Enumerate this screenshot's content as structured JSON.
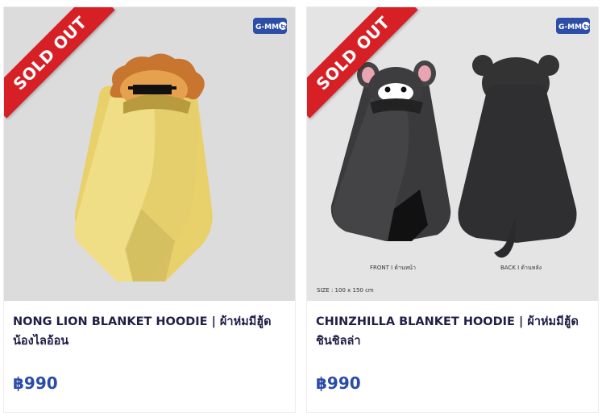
{
  "products": [
    {
      "badge": "SOLD OUT",
      "logo_text": "GMMTV",
      "title_line1": "NONG LION BLANKET HOODIE | ผ้าห่มมีฮู้ด",
      "title_line2": "น้องไลอ้อน",
      "price": "฿990"
    },
    {
      "badge": "SOLD OUT",
      "logo_text": "GMMTV",
      "title_line1": "CHINZHILLA BLANKET HOODIE | ผ้าห่มมีฮู้ด",
      "title_line2": "ชินชิลล่า",
      "price": "฿990",
      "caption_front": "FRONT I ด้านหน้า",
      "caption_back": "BACK I ด้านหลัง",
      "caption_size": "SIZE : 100 x 150 cm"
    }
  ],
  "colors": {
    "ribbon": "#d71f26",
    "price": "#2b4baa",
    "title": "#1f1f47",
    "lion_blanket": "#eedd7a",
    "chinchilla_blanket": "#3a3a3c"
  }
}
